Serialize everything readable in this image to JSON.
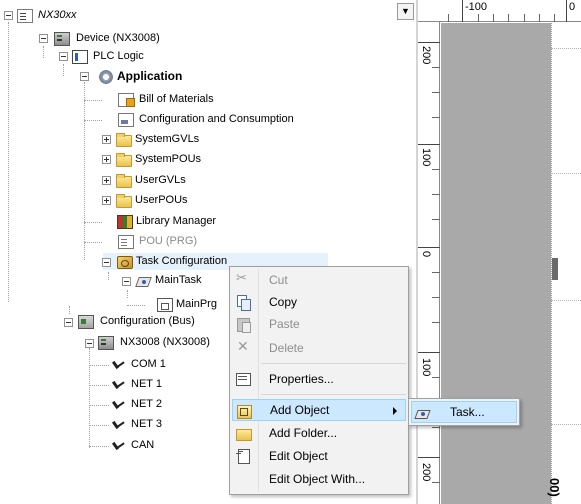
{
  "tree": {
    "project_name": "NX30xx",
    "device": "Device (NX3008)",
    "plc_logic": "PLC Logic",
    "application": "Application",
    "bill_of_materials": "Bill of Materials",
    "configuration_consumption": "Configuration and Consumption",
    "system_gvls": "SystemGVLs",
    "system_pous": "SystemPOUs",
    "user_gvls": "UserGVLs",
    "user_pous": "UserPOUs",
    "library_manager": "Library Manager",
    "pou_prg": "POU (PRG)",
    "task_configuration": "Task Configuration",
    "main_task": "MainTask",
    "main_prg": "MainPrg",
    "configuration_bus": "Configuration (Bus)",
    "nx3008": "NX3008 (NX3008)",
    "com1": "COM 1",
    "net1": "NET 1",
    "net2": "NET 2",
    "net3": "NET 3",
    "can": "CAN"
  },
  "ruler": {
    "top_labels": [
      "-100",
      "0"
    ],
    "left_labels": [
      "200",
      "100",
      "0",
      "100",
      "200"
    ],
    "bottom_text": "00)"
  },
  "context_menu": {
    "items": [
      {
        "label": "Cut",
        "icon": "scissors-icon",
        "enabled": false
      },
      {
        "label": "Copy",
        "icon": "copy-icon",
        "enabled": true
      },
      {
        "label": "Paste",
        "icon": "paste-icon",
        "enabled": false
      },
      {
        "label": "Delete",
        "icon": "delete-icon",
        "enabled": false
      },
      {
        "label": "Properties...",
        "icon": "properties-icon",
        "enabled": true
      },
      {
        "label": "Add Object",
        "icon": "add-object-icon",
        "enabled": true
      },
      {
        "label": "Add Folder...",
        "icon": "folder-icon",
        "enabled": true
      },
      {
        "label": "Edit Object",
        "icon": "edit-icon",
        "enabled": true
      },
      {
        "label": "Edit Object With...",
        "icon": "none",
        "enabled": true
      }
    ]
  },
  "submenu": {
    "items": [
      {
        "label": "Task...",
        "icon": "task-icon"
      }
    ]
  },
  "colors": {
    "menu_highlight": "#cce8ff",
    "tree_row_highlight": "#e5f1fb",
    "canvas_gray": "#a9a9a9"
  }
}
